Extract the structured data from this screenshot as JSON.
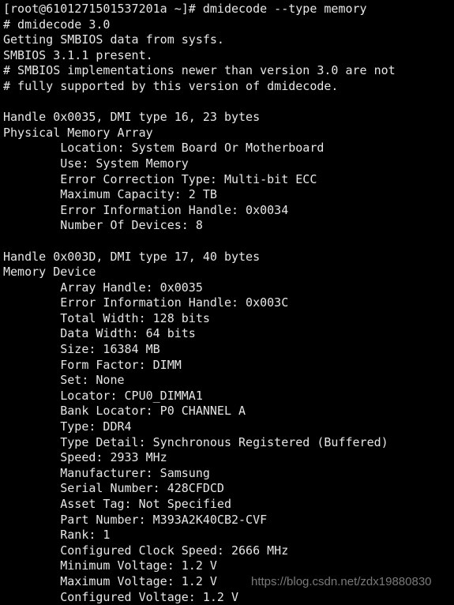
{
  "terminal": {
    "background_color": "#000000",
    "text_color": "#e6e6e6",
    "prompt": {
      "user": "root",
      "host": "6101271501537201a",
      "cwd": "~",
      "symbol": "#",
      "full": "[root@6101271501537201a ~]#"
    },
    "command": "dmidecode --type memory",
    "lines": [
      "[root@6101271501537201a ~]# dmidecode --type memory",
      "# dmidecode 3.0",
      "Getting SMBIOS data from sysfs.",
      "SMBIOS 3.1.1 present.",
      "# SMBIOS implementations newer than version 3.0 are not",
      "# fully supported by this version of dmidecode.",
      "",
      "Handle 0x0035, DMI type 16, 23 bytes",
      "Physical Memory Array",
      "        Location: System Board Or Motherboard",
      "        Use: System Memory",
      "        Error Correction Type: Multi-bit ECC",
      "        Maximum Capacity: 2 TB",
      "        Error Information Handle: 0x0034",
      "        Number Of Devices: 8",
      "",
      "Handle 0x003D, DMI type 17, 40 bytes",
      "Memory Device",
      "        Array Handle: 0x0035",
      "        Error Information Handle: 0x003C",
      "        Total Width: 128 bits",
      "        Data Width: 64 bits",
      "        Size: 16384 MB",
      "        Form Factor: DIMM",
      "        Set: None",
      "        Locator: CPU0_DIMMA1",
      "        Bank Locator: P0 CHANNEL A",
      "        Type: DDR4",
      "        Type Detail: Synchronous Registered (Buffered)",
      "        Speed: 2933 MHz",
      "        Manufacturer: Samsung",
      "        Serial Number: 428CFDCD",
      "        Asset Tag: Not Specified",
      "        Part Number: M393A2K40CB2-CVF",
      "        Rank: 1",
      "        Configured Clock Speed: 2666 MHz",
      "        Minimum Voltage: 1.2 V",
      "        Maximum Voltage: 1.2 V",
      "        Configured Voltage: 1.2 V"
    ],
    "sections": {
      "dmidecode_header": {
        "version_line": "# dmidecode 3.0",
        "source_line": "Getting SMBIOS data from sysfs.",
        "smbios_version_line": "SMBIOS 3.1.1 present.",
        "warning_line_1": "# SMBIOS implementations newer than version 3.0 are not",
        "warning_line_2": "# fully supported by this version of dmidecode."
      },
      "physical_memory_array": {
        "handle_line": "Handle 0x0035, DMI type 16, 23 bytes",
        "title": "Physical Memory Array",
        "fields": [
          {
            "key": "Location",
            "value": "System Board Or Motherboard"
          },
          {
            "key": "Use",
            "value": "System Memory"
          },
          {
            "key": "Error Correction Type",
            "value": "Multi-bit ECC"
          },
          {
            "key": "Maximum Capacity",
            "value": "2 TB"
          },
          {
            "key": "Error Information Handle",
            "value": "0x0034"
          },
          {
            "key": "Number Of Devices",
            "value": "8"
          }
        ]
      },
      "memory_device": {
        "handle_line": "Handle 0x003D, DMI type 17, 40 bytes",
        "title": "Memory Device",
        "fields": [
          {
            "key": "Array Handle",
            "value": "0x0035"
          },
          {
            "key": "Error Information Handle",
            "value": "0x003C"
          },
          {
            "key": "Total Width",
            "value": "128 bits"
          },
          {
            "key": "Data Width",
            "value": "64 bits"
          },
          {
            "key": "Size",
            "value": "16384 MB"
          },
          {
            "key": "Form Factor",
            "value": "DIMM"
          },
          {
            "key": "Set",
            "value": "None"
          },
          {
            "key": "Locator",
            "value": "CPU0_DIMMA1"
          },
          {
            "key": "Bank Locator",
            "value": "P0 CHANNEL A"
          },
          {
            "key": "Type",
            "value": "DDR4"
          },
          {
            "key": "Type Detail",
            "value": "Synchronous Registered (Buffered)"
          },
          {
            "key": "Speed",
            "value": "2933 MHz"
          },
          {
            "key": "Manufacturer",
            "value": "Samsung"
          },
          {
            "key": "Serial Number",
            "value": "428CFDCD"
          },
          {
            "key": "Asset Tag",
            "value": "Not Specified"
          },
          {
            "key": "Part Number",
            "value": "M393A2K40CB2-CVF"
          },
          {
            "key": "Rank",
            "value": "1"
          },
          {
            "key": "Configured Clock Speed",
            "value": "2666 MHz"
          },
          {
            "key": "Minimum Voltage",
            "value": "1.2 V"
          },
          {
            "key": "Maximum Voltage",
            "value": "1.2 V"
          },
          {
            "key": "Configured Voltage",
            "value": "1.2 V"
          }
        ]
      }
    }
  },
  "watermark": {
    "text": "https://blog.csdn.net/zdx19880830",
    "color": "#8f8f8f"
  }
}
